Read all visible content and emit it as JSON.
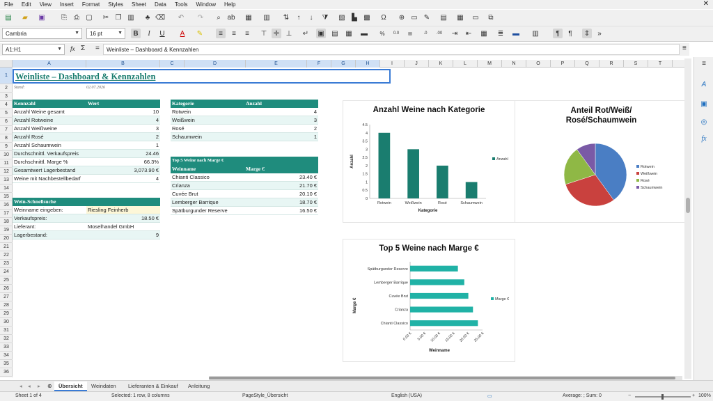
{
  "menu": [
    "File",
    "Edit",
    "View",
    "Insert",
    "Format",
    "Styles",
    "Sheet",
    "Data",
    "Tools",
    "Window",
    "Help"
  ],
  "format_bar": {
    "font_name": "Cambria",
    "font_size": "16 pt"
  },
  "formula_bar": {
    "name_box": "A1:H1",
    "function_wizard": "fx",
    "sum_symbol": "Σ",
    "equals": "=",
    "content": "Weinliste – Dashboard & Kennzahlen"
  },
  "columns": [
    "A",
    "B",
    "C",
    "D",
    "E",
    "F",
    "G",
    "H",
    "I",
    "J",
    "K",
    "L",
    "M",
    "N",
    "O",
    "P",
    "Q",
    "R",
    "S",
    "T"
  ],
  "rows": [
    "1",
    "2",
    "3",
    "4",
    "5",
    "6",
    "7",
    "8",
    "9",
    "10",
    "11",
    "12",
    "13",
    "14",
    "15",
    "16",
    "17",
    "18",
    "19",
    "20",
    "21",
    "22",
    "23",
    "24",
    "25",
    "26",
    "27",
    "28",
    "29",
    "30",
    "31",
    "32",
    "33",
    "34",
    "35",
    "36"
  ],
  "sheet": {
    "title": "Weinliste – Dashboard & Kennzahlen",
    "stand_label": "Stand:",
    "stand_date": "02.07.2026",
    "kennzahl": {
      "headers": [
        "Kennzahl",
        "Wert"
      ],
      "rows": [
        {
          "label": "Anzahl Weine gesamt",
          "value": "10"
        },
        {
          "label": "Anzahl Rotweine",
          "value": "4"
        },
        {
          "label": "Anzahl Weißweine",
          "value": "3"
        },
        {
          "label": "Anzahl Rosé",
          "value": "2"
        },
        {
          "label": "Anzahl Schaumwein",
          "value": "1"
        },
        {
          "label": "Durchschnittl. Verkaufspreis",
          "value": "24.46"
        },
        {
          "label": "Durchschnittl. Marge %",
          "value": "66.3%"
        },
        {
          "label": "Gesamtwert Lagerbestand",
          "value": "3,073.90 €"
        },
        {
          "label": "Weine mit Nachbestellbedarf",
          "value": "4"
        }
      ]
    },
    "kategorie": {
      "headers": [
        "Kategorie",
        "Anzahl"
      ],
      "rows": [
        {
          "label": "Rotwein",
          "value": "4"
        },
        {
          "label": "Weißwein",
          "value": "3"
        },
        {
          "label": "Rosé",
          "value": "2"
        },
        {
          "label": "Schaumwein",
          "value": "1"
        }
      ]
    },
    "top5": {
      "title": "Top 5 Weine nach Marge €",
      "headers": [
        "Weinname",
        "Marge €"
      ],
      "rows": [
        {
          "label": "Chianti Classico",
          "value": "23.40 €"
        },
        {
          "label": "Crianza",
          "value": "21.70 €"
        },
        {
          "label": "Cuvée Brut",
          "value": "20.10 €"
        },
        {
          "label": "Lemberger Barrique",
          "value": "18.70 €"
        },
        {
          "label": "Spätburgunder Reserve",
          "value": "16.50 €"
        }
      ]
    },
    "search": {
      "title": "Wein-Schnellsuche",
      "rows": [
        {
          "label": "Weinname eingeben:",
          "value": "Riesling Feinherb"
        },
        {
          "label": "Verkaufspreis:",
          "value": "18.50 €"
        },
        {
          "label": "Lieferant:",
          "value": "Moselhandel GmbH"
        },
        {
          "label": "Lagerbestand:",
          "value": "9"
        }
      ]
    }
  },
  "chart_data": [
    {
      "type": "bar",
      "title": "Anzahl Weine nach Kategorie",
      "xlabel": "Kategorie",
      "ylabel": "Anzahl",
      "categories": [
        "Rotwein",
        "Weißwein",
        "Rosé",
        "Schaumwein"
      ],
      "series": [
        {
          "name": "Anzahl",
          "values": [
            4,
            3,
            2,
            1
          ]
        }
      ],
      "ylim": [
        0,
        4.5
      ],
      "yticks": [
        "0",
        "0.5",
        "1",
        "1.5",
        "2",
        "2.5",
        "3",
        "3.5",
        "4",
        "4.5"
      ],
      "grid": false,
      "legend": "right",
      "color": "#1a7d6f"
    },
    {
      "type": "pie",
      "title": "Anteil Rot/Weiß/\nRosé/Schaumwein",
      "title_lines": [
        "Anteil Rot/Weiß/",
        "Rosé/Schaumwein"
      ],
      "categories": [
        "Rotwein",
        "Weißwein",
        "Rosé",
        "Schaumwein"
      ],
      "values": [
        4,
        3,
        2,
        1
      ],
      "colors": [
        "#4a7ec4",
        "#c9413e",
        "#8fb845",
        "#7a5aa6"
      ],
      "legend": "right"
    },
    {
      "type": "bar",
      "orientation": "horizontal",
      "title": "Top 5 Weine nach Marge €",
      "xlabel": "Weinname",
      "ylabel": "Marge €",
      "categories": [
        "Chianti Classico",
        "Crianza",
        "Cuvée Brut",
        "Lemberger Barrique",
        "Spätburgunder Reserve"
      ],
      "series": [
        {
          "name": "Marge €",
          "values": [
            23.4,
            21.7,
            20.1,
            18.7,
            16.5
          ]
        }
      ],
      "xlim": [
        0,
        25
      ],
      "xticks": [
        "0.00 €",
        "5.00 €",
        "10.00 €",
        "15.00 €",
        "20.00 €",
        "25.00 €"
      ],
      "grid": false,
      "legend": "right",
      "color": "#20b2a6"
    }
  ],
  "tabs": [
    "Übersicht",
    "Weindaten",
    "Lieferanten & Einkauf",
    "Anleitung"
  ],
  "status": {
    "sheet": "Sheet 1 of 4",
    "selection": "Selected: 1 row, 8 columns",
    "pagestyle": "PageStyle_Übersicht",
    "language": "English (USA)",
    "summary": "Average: ; Sum: 0",
    "zoom": "100%"
  },
  "colors": {
    "accent": "#1f8c7d",
    "band": "#e8f6f4",
    "selection": "#3a7bd5"
  }
}
